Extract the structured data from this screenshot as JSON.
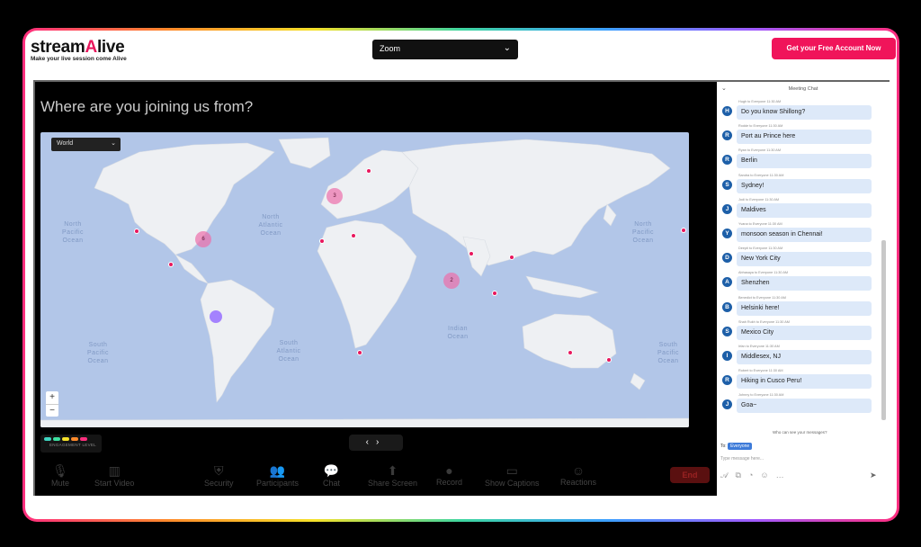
{
  "brand": {
    "name_part1": "stream",
    "name_part2": "A",
    "name_part3": "live",
    "tagline": "Make your live session come Alive"
  },
  "platform_select": {
    "value": "Zoom"
  },
  "cta_button": "Get your Free Account Now",
  "stage": {
    "question": "Where are you joining us from?",
    "region_select": "World",
    "zoom_in": "+",
    "zoom_out": "−",
    "ocean_labels": [
      "North Pacific Ocean",
      "North Atlantic Ocean",
      "South Pacific Ocean",
      "South Atlantic Ocean",
      "Indian Ocean",
      "North Pacific Ocean",
      "South Pacific Ocean"
    ],
    "clusters": [
      "3",
      "6",
      "2",
      ""
    ],
    "engagement_label": "ENGAGEMENT LEVEL",
    "engagement_colors": [
      "#3fd6c0",
      "#3de0a0",
      "#f5e12a",
      "#ff8a2b",
      "#ff2e7e"
    ],
    "nav_prev": "‹",
    "nav_next": "›"
  },
  "controls": [
    {
      "label": "Mute",
      "icon": "mic-icon"
    },
    {
      "label": "Start Video",
      "icon": "video-off-icon"
    },
    {
      "label": "Security",
      "icon": "shield-icon"
    },
    {
      "label": "Participants",
      "icon": "people-icon"
    },
    {
      "label": "Chat",
      "icon": "chat-icon"
    },
    {
      "label": "Share Screen",
      "icon": "share-screen-icon"
    },
    {
      "label": "Record",
      "icon": "record-icon"
    },
    {
      "label": "Show Captions",
      "icon": "cc-icon"
    },
    {
      "label": "Reactions",
      "icon": "emoji-icon"
    }
  ],
  "end_button": "End",
  "chat": {
    "title": "Meeting Chat",
    "messages": [
      {
        "initial": "H",
        "meta": "Hugh to Everyone      11:30 AM",
        "text": "Do you know Shillong?"
      },
      {
        "initial": "R",
        "meta": "Rodde to Everyone      11:30 AM",
        "text": "Port au Prince here"
      },
      {
        "initial": "R",
        "meta": "Ryan to Everyone      11:30 AM",
        "text": "Berlin"
      },
      {
        "initial": "S",
        "meta": "Sandra to Everyone      11:30 AM",
        "text": "Sydney!"
      },
      {
        "initial": "J",
        "meta": "Jodi to Everyone      11:30 AM",
        "text": "Maldives"
      },
      {
        "initial": "Y",
        "meta": "Yvana to Everyone      11:30 AM",
        "text": "monsoon season in Chennai!"
      },
      {
        "initial": "D",
        "meta": "Deepti to Everyone      11:30 AM",
        "text": "New York City"
      },
      {
        "initial": "A",
        "meta": "Abhasaya to Everyone      11:30 AM",
        "text": "Shenzhen"
      },
      {
        "initial": "B",
        "meta": "Benedict to Everyone      11:30 AM",
        "text": "Helsinki here!"
      },
      {
        "initial": "S",
        "meta": "Shah Rukh to Everyone      11:30 AM",
        "text": "Mexico City"
      },
      {
        "initial": "I",
        "meta": "Irfan to Everyone      11:30 AM",
        "text": "Middlesex, NJ"
      },
      {
        "initial": "R",
        "meta": "Robert to Everyone      11:30 AM",
        "text": "Hiking in Cusco Peru!"
      },
      {
        "initial": "J",
        "meta": "Johnny to Everyone      11:30 AM",
        "text": "Goa~"
      }
    ],
    "who_can_see": "Who can see your messages?",
    "to_label": "To:",
    "to_value": "Everyone",
    "placeholder": "Type message here..."
  }
}
